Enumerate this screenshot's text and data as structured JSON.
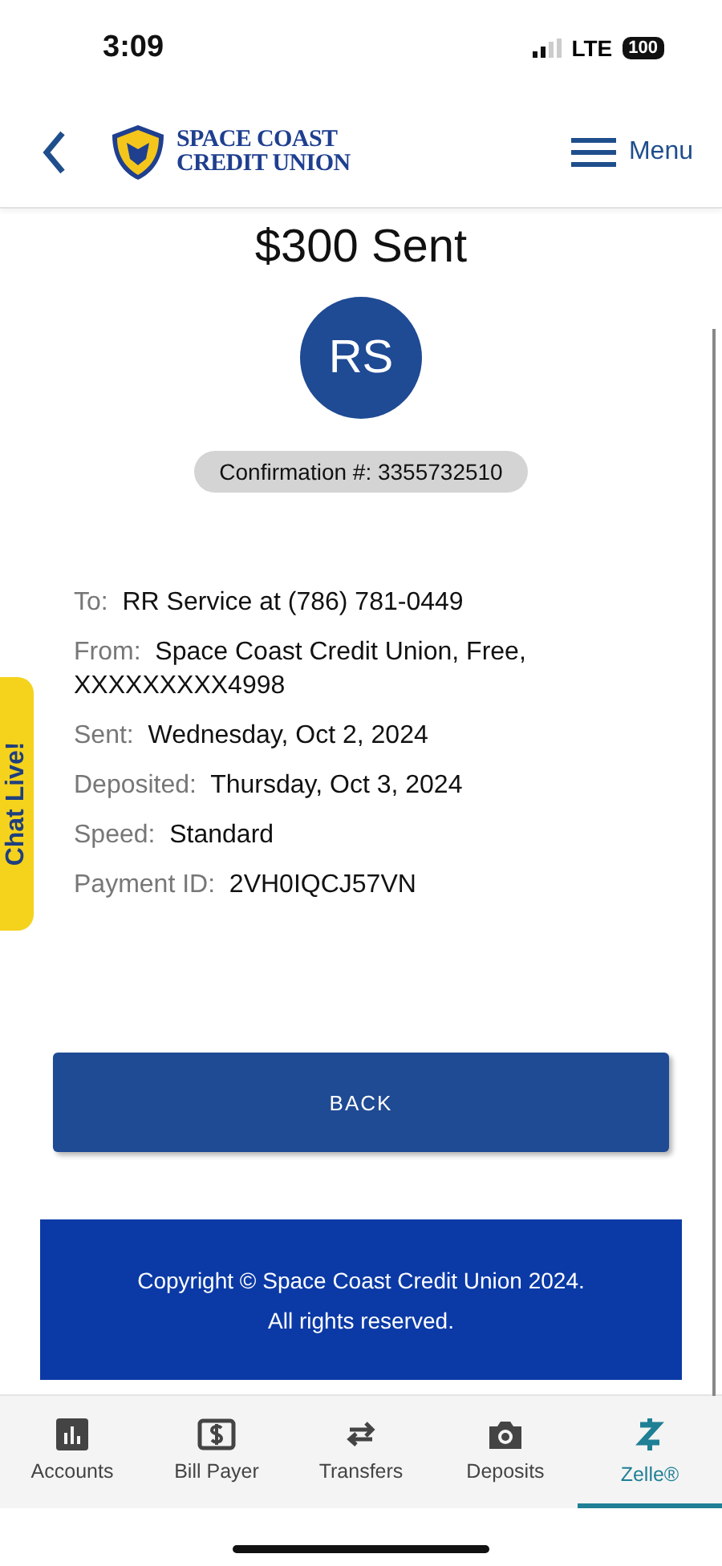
{
  "status_bar": {
    "time": "3:09",
    "network": "LTE",
    "battery": "100"
  },
  "header": {
    "logo_line_1": "SPACE COAST",
    "logo_line_2": "CREDIT UNION",
    "menu_label": "Menu"
  },
  "title": "$300 Sent",
  "avatar": "RS",
  "confirmation": "Confirmation #: 3355732510",
  "details": [
    {
      "label": "To:",
      "value": "RR Service at (786) 781-0449"
    },
    {
      "label": "From:",
      "value": "Space Coast Credit Union, Free, XXXXXXXXX4998"
    },
    {
      "label": "Sent:",
      "value": "Wednesday, Oct 2, 2024"
    },
    {
      "label": "Deposited:",
      "value": "Thursday, Oct 3, 2024"
    },
    {
      "label": "Speed:",
      "value": "Standard"
    },
    {
      "label": "Payment ID:",
      "value": "2VH0IQCJ57VN"
    }
  ],
  "chat_tab": "Chat Live!",
  "back_button": "BACK",
  "footer": {
    "line_1": "Copyright © Space Coast Credit Union 2024.",
    "line_2": "All rights reserved."
  },
  "tabs": [
    {
      "kind": "accounts",
      "label": "Accounts",
      "selected": false
    },
    {
      "kind": "bill",
      "label": "Bill Payer",
      "selected": false
    },
    {
      "kind": "transfers",
      "label": "Transfers",
      "selected": false
    },
    {
      "kind": "deposits",
      "label": "Deposits",
      "selected": false
    },
    {
      "kind": "zelle",
      "label": "Zelle®",
      "selected": true
    }
  ]
}
